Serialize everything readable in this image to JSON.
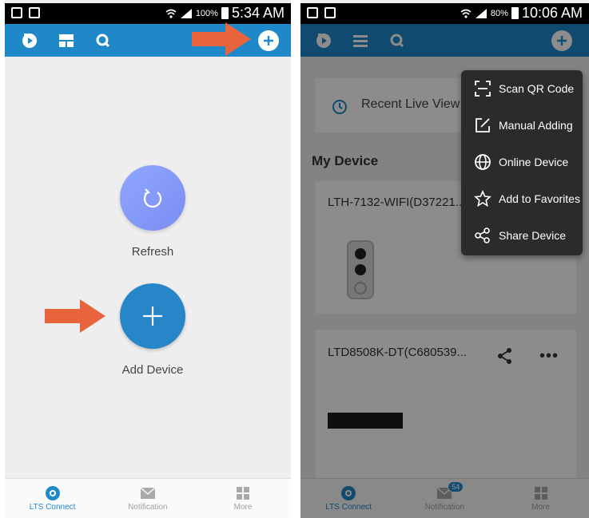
{
  "colors": {
    "accent": "#1e88c8",
    "arrow": "#e8643c",
    "menu_bg": "#2b2b2b"
  },
  "left": {
    "status": {
      "battery": "100%",
      "time": "5:34 AM"
    },
    "appbar_icons": [
      "playback-icon",
      "layout-icon",
      "search-icon",
      "add-circle-icon"
    ],
    "refresh_label": "Refresh",
    "add_device_label": "Add Device",
    "tabs": [
      {
        "label": "LTS Connect",
        "active": true
      },
      {
        "label": "Notification",
        "active": false
      },
      {
        "label": "More",
        "active": false
      }
    ]
  },
  "right": {
    "status": {
      "battery": "80%",
      "time": "10:06 AM"
    },
    "recent_live_view": "Recent Live View",
    "section_title": "My Device",
    "devices": [
      {
        "name": "LTH-7132-WIFI(D37221..."
      },
      {
        "name": "LTD8508K-DT(C680539..."
      }
    ],
    "menu": [
      {
        "label": "Scan QR Code",
        "icon": "qr-scan-icon"
      },
      {
        "label": "Manual Adding",
        "icon": "edit-icon"
      },
      {
        "label": "Online Device",
        "icon": "globe-icon"
      },
      {
        "label": "Add to Favorites",
        "icon": "star-icon"
      },
      {
        "label": "Share Device",
        "icon": "share-icon"
      }
    ],
    "notification_badge": "54",
    "tabs": [
      {
        "label": "LTS Connect",
        "active": true
      },
      {
        "label": "Notification",
        "active": false
      },
      {
        "label": "More",
        "active": false
      }
    ]
  }
}
